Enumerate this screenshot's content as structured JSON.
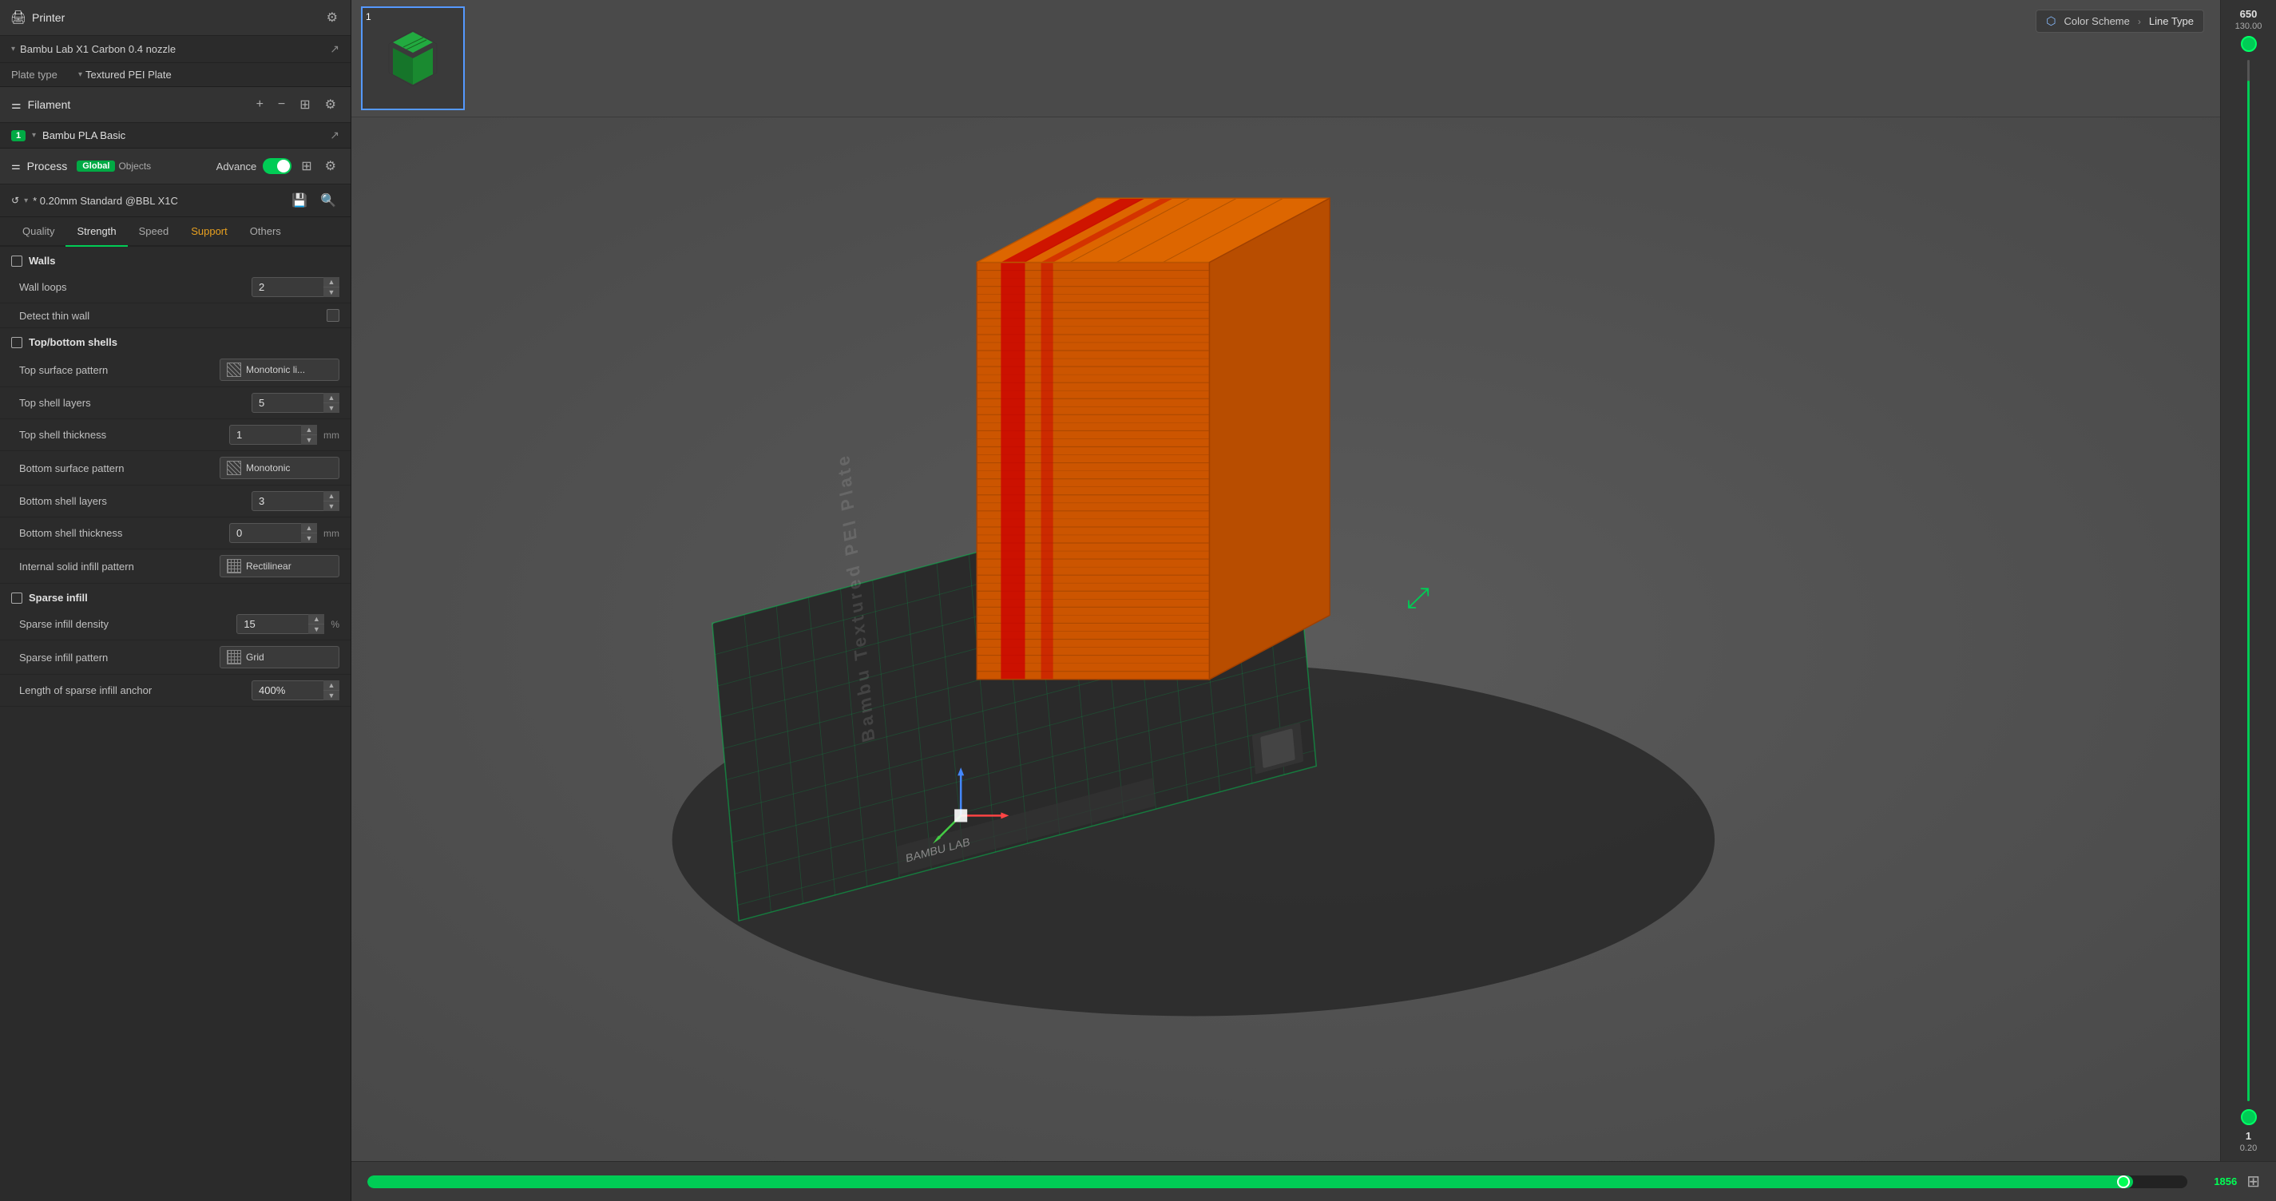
{
  "printer": {
    "section_label": "Printer",
    "printer_name": "Bambu Lab X1 Carbon 0.4 nozzle",
    "plate_label": "Plate type",
    "plate_value": "Textured PEI Plate"
  },
  "filament": {
    "section_label": "Filament",
    "filament_name": "Bambu PLA Basic",
    "filament_number": "1"
  },
  "process": {
    "section_label": "Process",
    "badge_global": "Global",
    "badge_objects": "Objects",
    "advance_label": "Advance",
    "profile_name": "* 0.20mm Standard @BBL X1C",
    "tabs": [
      {
        "label": "Quality",
        "active": false,
        "special": false
      },
      {
        "label": "Strength",
        "active": true,
        "special": false
      },
      {
        "label": "Speed",
        "active": false,
        "special": false
      },
      {
        "label": "Support",
        "active": false,
        "special": true
      },
      {
        "label": "Others",
        "active": false,
        "special": false
      }
    ]
  },
  "walls": {
    "group_label": "Walls",
    "settings": [
      {
        "label": "Wall loops",
        "type": "number",
        "value": "2"
      },
      {
        "label": "Detect thin wall",
        "type": "checkbox",
        "value": false
      }
    ]
  },
  "top_bottom_shells": {
    "group_label": "Top/bottom shells",
    "settings": [
      {
        "label": "Top surface pattern",
        "type": "dropdown",
        "value": "Monotonic li...",
        "pattern": "lines"
      },
      {
        "label": "Top shell layers",
        "type": "number",
        "value": "5"
      },
      {
        "label": "Top shell thickness",
        "type": "number",
        "value": "1",
        "unit": "mm"
      },
      {
        "label": "Bottom surface pattern",
        "type": "dropdown",
        "value": "Monotonic",
        "pattern": "lines"
      },
      {
        "label": "Bottom shell layers",
        "type": "number",
        "value": "3"
      },
      {
        "label": "Bottom shell thickness",
        "type": "number",
        "value": "0",
        "unit": "mm"
      },
      {
        "label": "Internal solid infill pattern",
        "type": "dropdown",
        "value": "Rectilinear",
        "pattern": "grid"
      }
    ]
  },
  "sparse_infill": {
    "group_label": "Sparse infill",
    "settings": [
      {
        "label": "Sparse infill density",
        "type": "number",
        "value": "15",
        "unit": "%"
      },
      {
        "label": "Sparse infill pattern",
        "type": "dropdown",
        "value": "Grid",
        "pattern": "grid"
      },
      {
        "label": "Length of sparse infill anchor",
        "type": "number",
        "value": "400%"
      }
    ]
  },
  "color_scheme": {
    "label": "Color Scheme",
    "value": "Line Type"
  },
  "layer_slider": {
    "top_value": "650",
    "top_sub": "130.00",
    "bottom_value": "1",
    "bottom_sub": "0.20"
  },
  "progress": {
    "value": 1856,
    "percent": 97
  },
  "plate_text": "Bambu Textured PEI Plate"
}
